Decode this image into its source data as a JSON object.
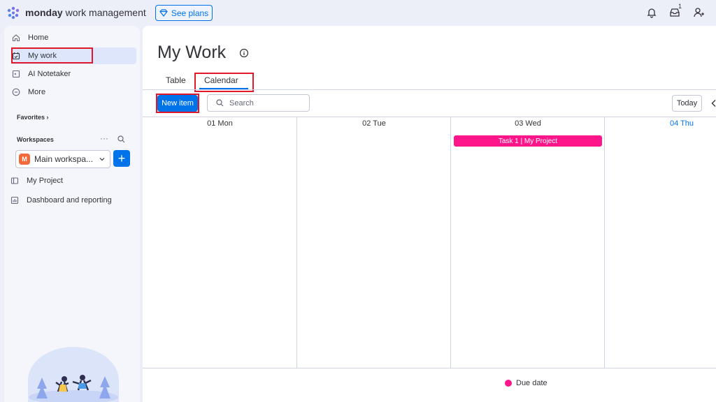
{
  "header": {
    "brand_bold": "monday",
    "brand_light": " work management",
    "see_plans": "See plans",
    "inbox_badge": "1",
    "icons": [
      "bell-icon",
      "inbox-icon",
      "invite-user-icon"
    ]
  },
  "sidebar": {
    "items": [
      {
        "label": "Home",
        "icon": "home-icon"
      },
      {
        "label": "My work",
        "icon": "calendar-check-icon"
      },
      {
        "label": "AI Notetaker",
        "icon": "notetaker-icon"
      },
      {
        "label": "More",
        "icon": "more-icon"
      }
    ],
    "favorites": "Favorites",
    "workspaces": "Workspaces",
    "workspace_name": "Main workspa...",
    "workspace_initial": "M",
    "boards": [
      {
        "label": "My Project",
        "icon": "board-icon"
      },
      {
        "label": "Dashboard and reporting",
        "icon": "dashboard-icon"
      }
    ]
  },
  "main": {
    "title": "My Work",
    "tabs": [
      "Table",
      "Calendar"
    ],
    "active_tab": "Calendar",
    "new_item": "New item",
    "search_placeholder": "Search",
    "today": "Today",
    "days": [
      {
        "label": "01 Mon",
        "current": false
      },
      {
        "label": "02 Tue",
        "current": false
      },
      {
        "label": "03 Wed",
        "current": false
      },
      {
        "label": "04 Thu",
        "current": true
      }
    ],
    "event": {
      "label": "Task 1 | My Project",
      "day": "03 Wed",
      "color": "#ff158a"
    },
    "legend": "Due date"
  },
  "colors": {
    "accent": "#0073ea",
    "highlight": "#e0182a",
    "event": "#ff158a"
  }
}
